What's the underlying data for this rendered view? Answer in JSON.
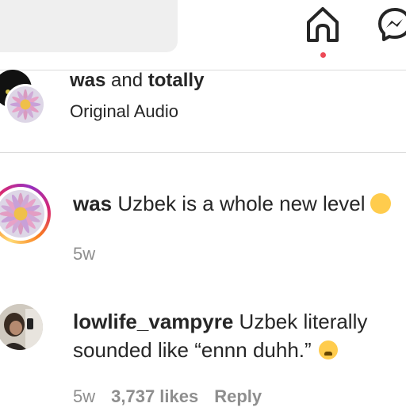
{
  "header": {
    "nav": [
      {
        "name": "home",
        "icon": "home-icon",
        "active": true
      },
      {
        "name": "messenger",
        "icon": "messenger-icon"
      }
    ],
    "active_indicator_color": "#ed4956"
  },
  "audio": {
    "title_part1": "was",
    "title_and": " and ",
    "title_part2": "totally",
    "subtitle": "Original Audio"
  },
  "comments": [
    {
      "username": "was",
      "text": " Uzbek is a whole new level",
      "emoji": "laughing-emoji",
      "time": "5w"
    },
    {
      "username": "lowlife_vampyre",
      "text": " Uzbek literally sounded like “ennn duhh.”",
      "emoji": "weary-emoji",
      "time": "5w",
      "likes": "3,737 likes",
      "reply": "Reply"
    }
  ],
  "colors": {
    "text": "#262626",
    "secondary": "#8e8e8e",
    "divider": "#dbdbdb",
    "search_bg": "#efefef"
  }
}
